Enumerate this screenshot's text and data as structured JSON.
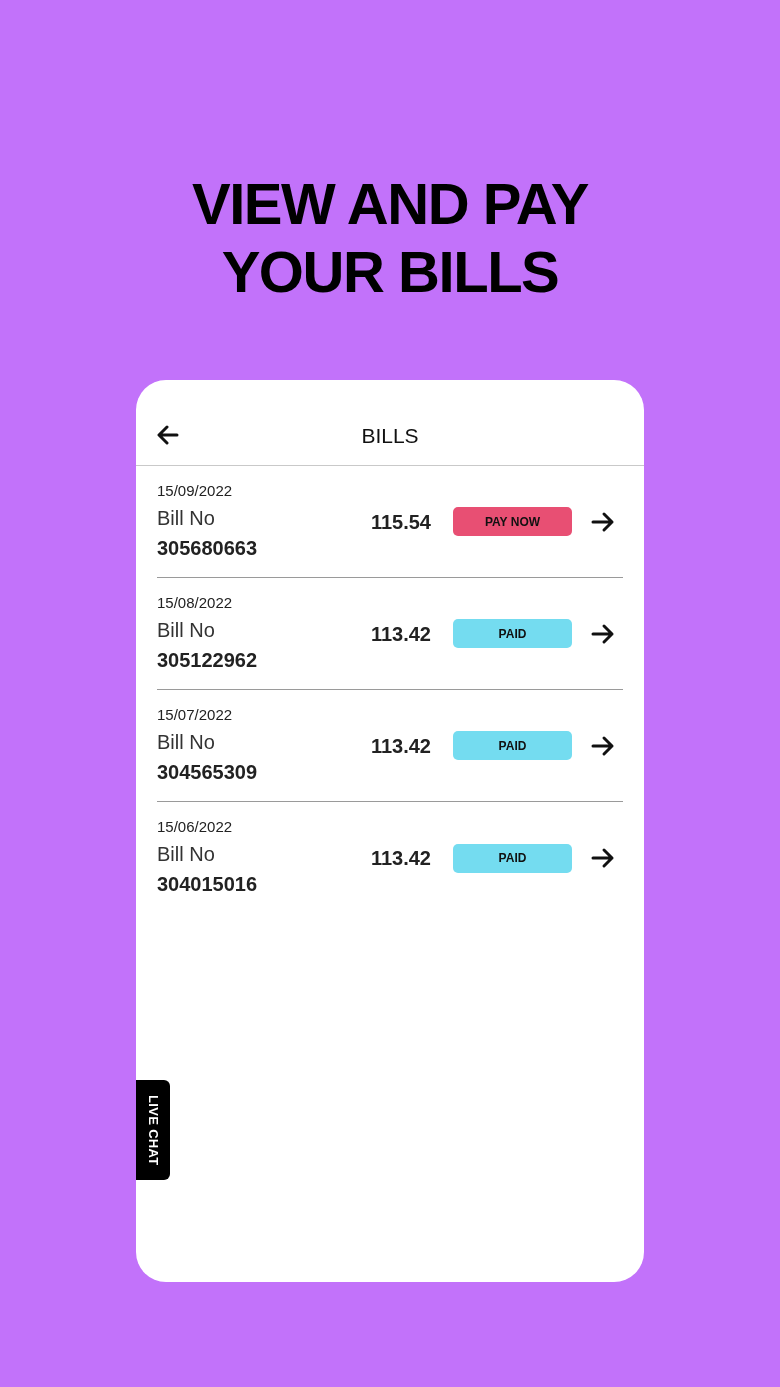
{
  "headline": [
    "VIEW AND PAY",
    "YOUR BILLS"
  ],
  "screen": {
    "title": "BILLS",
    "bills": [
      {
        "date": "15/09/2022",
        "label": "Bill No",
        "number": "305680663",
        "amount": "115.54",
        "status": {
          "kind": "unpaid",
          "text": "PAY NOW"
        }
      },
      {
        "date": "15/08/2022",
        "label": "Bill No",
        "number": "305122962",
        "amount": "113.42",
        "status": {
          "kind": "paid",
          "text": "PAID"
        }
      },
      {
        "date": "15/07/2022",
        "label": "Bill No",
        "number": "304565309",
        "amount": "113.42",
        "status": {
          "kind": "paid",
          "text": "PAID"
        }
      },
      {
        "date": "15/06/2022",
        "label": "Bill No",
        "number": "304015016",
        "amount": "113.42",
        "status": {
          "kind": "paid",
          "text": "PAID"
        }
      }
    ],
    "live_chat": "LIVE CHAT"
  }
}
